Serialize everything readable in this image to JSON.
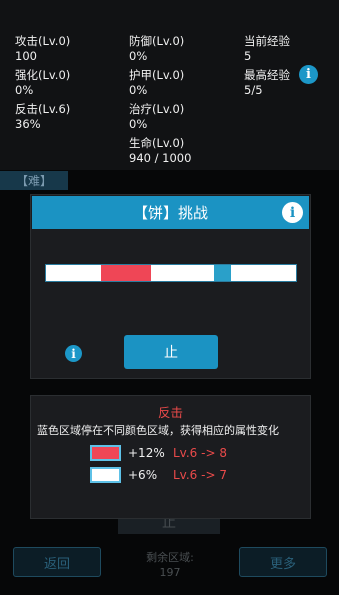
{
  "stats": {
    "attack": {
      "label": "攻击(Lv.0)",
      "value": "100"
    },
    "defense": {
      "label": "防御(Lv.0)",
      "value": "0%"
    },
    "current_exp": {
      "label": "当前经验",
      "value": "5"
    },
    "strengthen": {
      "label": "强化(Lv.0)",
      "value": "0%"
    },
    "armor": {
      "label": "护甲(Lv.0)",
      "value": "0%"
    },
    "max_exp": {
      "label": "最高经验",
      "value": "5/5"
    },
    "counter": {
      "label": "反击(Lv.6)",
      "value": "36%"
    },
    "heal": {
      "label": "治疗(Lv.0)",
      "value": "0%"
    },
    "life": {
      "label": "生命(Lv.0)",
      "value": "940 / 1000"
    }
  },
  "difficulty_tab": "【难】",
  "background": {
    "stop_label": "止",
    "back_label": "返回",
    "more_label": "更多",
    "remaining_label": "剩余区域:",
    "remaining_value": "197"
  },
  "modal": {
    "title": "【饼】挑战",
    "bar_segments": [
      {
        "color": "#ffffff",
        "start": 0.0,
        "end": 0.22
      },
      {
        "color": "#ef4656",
        "start": 0.22,
        "end": 0.42
      },
      {
        "color": "#ffffff",
        "start": 0.42,
        "end": 0.67
      },
      {
        "color": "#2aa0c9",
        "start": 0.67,
        "end": 0.74
      },
      {
        "color": "#ffffff",
        "start": 0.74,
        "end": 1.0
      }
    ],
    "stop_label": "止"
  },
  "description": {
    "title": "反击",
    "text": "蓝色区域停在不同颜色区域，获得相应的属性变化",
    "rows": [
      {
        "swatch_color": "#ef4656",
        "bonus": "+12%",
        "level_change": "Lv.6 -> 8"
      },
      {
        "swatch_color": "#ffffff",
        "bonus": "+6%",
        "level_change": "Lv.6 -> 7"
      }
    ]
  },
  "colors": {
    "accent": "#1b93c3",
    "danger": "#ef4656",
    "panel": "#1b1c1f"
  }
}
